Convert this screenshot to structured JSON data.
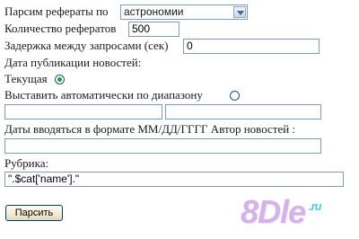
{
  "form": {
    "parse_label": "Парсим рефераты по",
    "parse_select_value": "астрономии",
    "count_label": "Количество рефератов",
    "count_value": "500",
    "delay_label": "Задержка между запросами (сек)",
    "delay_value": "0",
    "news_date_label": "Дата публикации новостей:",
    "current_label": "Текущая",
    "auto_range_label": "Выставить автоматически по диапазону",
    "range_start_value": "",
    "range_end_value": "",
    "date_format_label": "Даты вводяться в формате ММ/ДД/ГГГГ Автор новостей :",
    "author_value": "",
    "rubric_label": "Рубрика:",
    "rubric_value": "\".$cat['name'].\"",
    "submit_label": "Парсить"
  },
  "logo": {
    "text": "8Dle",
    "suffix": ".ru"
  },
  "colors": {
    "logo_main": "#d4b3e6",
    "logo_suffix": "#55c7e8",
    "radio_dot": "#21a121"
  }
}
